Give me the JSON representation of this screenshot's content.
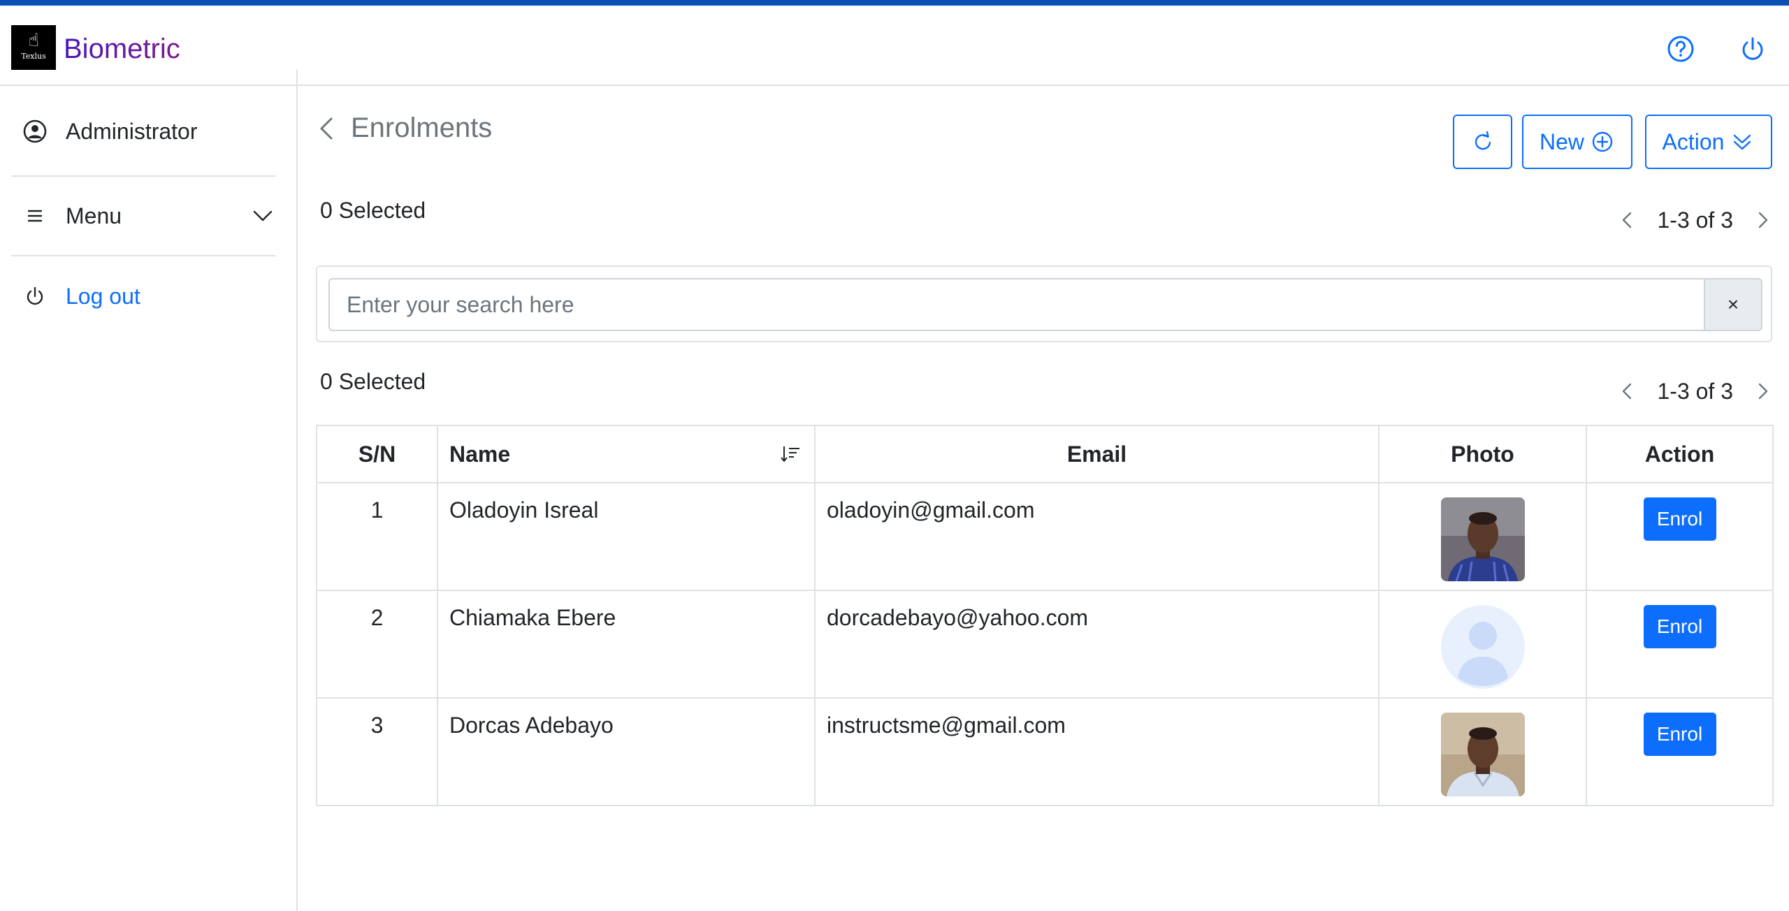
{
  "app": {
    "brand": "Biometric",
    "logo_caption": "Texlus",
    "logo_glyph": "☝"
  },
  "header": {
    "help_icon": "question-circle-icon",
    "power_icon": "power-icon"
  },
  "sidebar": {
    "user": "Administrator",
    "menu": "Menu",
    "logout": "Log out"
  },
  "page": {
    "title": "Enrolments",
    "buttons": {
      "refresh_icon": "refresh-icon",
      "new_label": "New",
      "action_label": "Action"
    },
    "top_selection": "0 Selected",
    "top_pagination": "1-3 of 3",
    "search_placeholder": "Enter your search here",
    "search_clear": "×",
    "table_selection": "0 Selected",
    "table_pagination": "1-3 of 3"
  },
  "table": {
    "headers": {
      "sn": "S/N",
      "name": "Name",
      "email": "Email",
      "photo": "Photo",
      "action": "Action"
    },
    "rows": [
      {
        "sn": "1",
        "name": "Oladoyin Isreal",
        "email": "oladoyin@gmail.com",
        "photo": "photo-man-blue-shirt",
        "action": "Enrol"
      },
      {
        "sn": "2",
        "name": "Chiamaka Ebere",
        "email": "dorcadebayo@yahoo.com",
        "photo": "placeholder-avatar",
        "action": "Enrol"
      },
      {
        "sn": "3",
        "name": "Dorcas Adebayo",
        "email": "instructsme@gmail.com",
        "photo": "photo-man-light-shirt",
        "action": "Enrol"
      }
    ]
  },
  "colors": {
    "accent": "#0d6efd",
    "topbar": "#0a4fb5",
    "brand_start": "#4a18b8",
    "brand_end": "#7a1a8a"
  }
}
